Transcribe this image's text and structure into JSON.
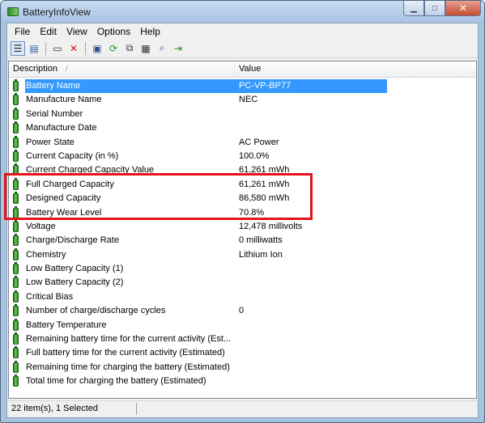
{
  "window": {
    "title": "BatteryInfoView"
  },
  "menu": [
    "File",
    "Edit",
    "View",
    "Options",
    "Help"
  ],
  "toolbar_icons": [
    "list-view-icon",
    "html-report-icon",
    "properties-window-icon",
    "delete-icon",
    "save-icon",
    "refresh-icon",
    "copy-icon",
    "properties-icon",
    "find-icon",
    "exit-icon"
  ],
  "columns": {
    "description": "Description",
    "value": "Value"
  },
  "rows": [
    {
      "desc": "Battery Name",
      "value": "PC-VP-BP77",
      "selected": true
    },
    {
      "desc": "Manufacture Name",
      "value": "NEC"
    },
    {
      "desc": "Serial Number",
      "value": ""
    },
    {
      "desc": "Manufacture Date",
      "value": ""
    },
    {
      "desc": "Power State",
      "value": "AC Power"
    },
    {
      "desc": "Current Capacity (in %)",
      "value": "100.0%"
    },
    {
      "desc": "Current Charged Capacity Value",
      "value": "61,261 mWh"
    },
    {
      "desc": "Full Charged Capacity",
      "value": "61,261 mWh"
    },
    {
      "desc": "Designed Capacity",
      "value": "86,580 mWh"
    },
    {
      "desc": "Battery Wear Level",
      "value": "70.8%"
    },
    {
      "desc": "Voltage",
      "value": "12,478 millivolts"
    },
    {
      "desc": "Charge/Discharge Rate",
      "value": "0 milliwatts"
    },
    {
      "desc": "Chemistry",
      "value": "Lithium Ion"
    },
    {
      "desc": "Low Battery Capacity (1)",
      "value": ""
    },
    {
      "desc": "Low Battery Capacity (2)",
      "value": ""
    },
    {
      "desc": "Critical Bias",
      "value": ""
    },
    {
      "desc": "Number of charge/discharge cycles",
      "value": "0"
    },
    {
      "desc": "Battery Temperature",
      "value": ""
    },
    {
      "desc": "Remaining battery time for the current activity (Est...",
      "value": ""
    },
    {
      "desc": "Full battery time for the current activity (Estimated)",
      "value": ""
    },
    {
      "desc": "Remaining time for charging the battery (Estimated)",
      "value": ""
    },
    {
      "desc": "Total  time for charging the battery (Estimated)",
      "value": ""
    }
  ],
  "status": {
    "text": "22 item(s), 1 Selected"
  },
  "colors": {
    "selection": "#3399ff",
    "highlight_box": "#e4121b"
  }
}
